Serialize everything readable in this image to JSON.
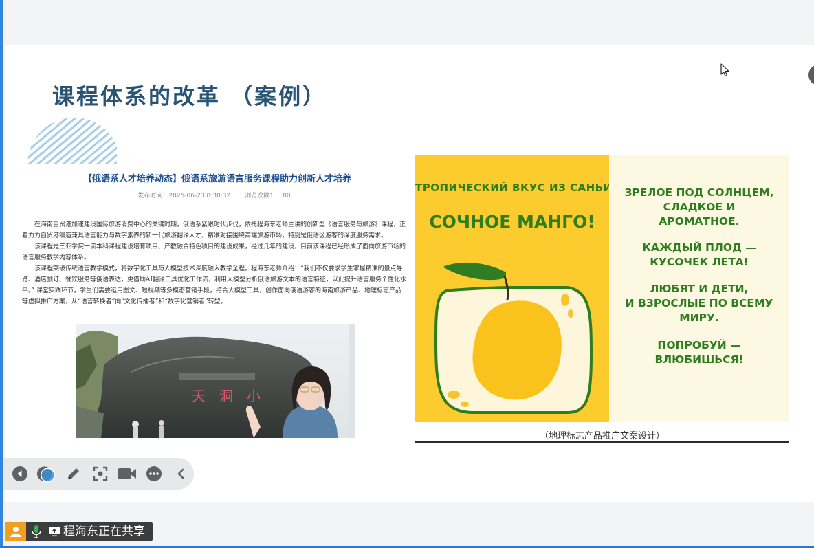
{
  "slide": {
    "title": "课程体系的改革 （案例）"
  },
  "article": {
    "headline": "【俄语系人才培养动态】俄语系旅游语言服务课程助力创新人才培养",
    "published_label": "发布时间：2025-06-23 8:38:32",
    "views_label": "浏览次数：",
    "views_count": "80",
    "paragraphs": [
      "在海南自贸港加速建设国际旅游消费中心的关键时期，俄语系紧跟时代步伐，依托程海东老师主讲的创新型《语言服务与旅游》课程，正着力为自贸港锻造兼具语言能力与数字素养的新一代旅游翻译人才，精准对接围绕高端旅游市场，特别是俄语区游客的深度服务需求。",
      "该课程是三亚学院一流本科课程建设培育项目、产教融合特色项目的建设成果，经过几年的建设，目前该课程已经形成了面向旅游市场的语言服务教学内容体系。",
      "该课程突破传统语言教学模式，将数字化工具与大模型技术深度融入教学全程。程海东老师介绍：“我们不仅要求学生掌握精准的景点导览、酒店预订、餐饮服务等俄语表达，更借助AI翻译工具优化工作流，利用大模型分析俄语旅游文本的语言特征，以此提升语言服务个性化水平。” 课堂实践环节，学生们需要运用图文、短视频等多模态营销手段，结合大模型工具，创作面向俄语游客的海南旅游产品、地理标志产品等虚拟推广方案，从“语言转换者”向“文化传播者”和“数字化营销者”转型。"
    ],
    "video_sign_text": "天涯海角 小洞天"
  },
  "poster": {
    "kicker": "ТРОПИЧЕСКИЙ ВКУС ИЗ САНЬИ",
    "headline": "СОЧНОЕ МАНГО!",
    "blocks": [
      "ЗРЕЛОЕ ПОД СОЛНЦЕМ,\nСЛАДКОЕ И\nАРОМАТНОЕ.",
      "КАЖДЫЙ ПЛОД —\nКУСОЧЕК ЛЕТА!",
      "ЛЮБЯТ И ДЕТИ,\nИ ВЗРОСЛЫЕ ПО ВСЕМУ\nМИРУ.",
      "ПОПРОБУЙ —\nВЛЮБИШЬСЯ!"
    ],
    "caption": "（地理标志产品推广文案设计）",
    "colors": {
      "yellow": "#fccb2e",
      "cream": "#fdf8e1",
      "green": "#2e7d1f"
    }
  },
  "toolbar": {
    "items": [
      "prev-slide-icon",
      "laser-pointer-icon",
      "pen-icon",
      "screenshot-icon",
      "video-camera-icon",
      "more-icon",
      "collapse-icon"
    ]
  },
  "share_status": {
    "text": "程海东正在共享"
  },
  "colors": {
    "title": "#2a5474",
    "accent_blue": "#1f7ae0",
    "share_orange": "#f0a020"
  }
}
